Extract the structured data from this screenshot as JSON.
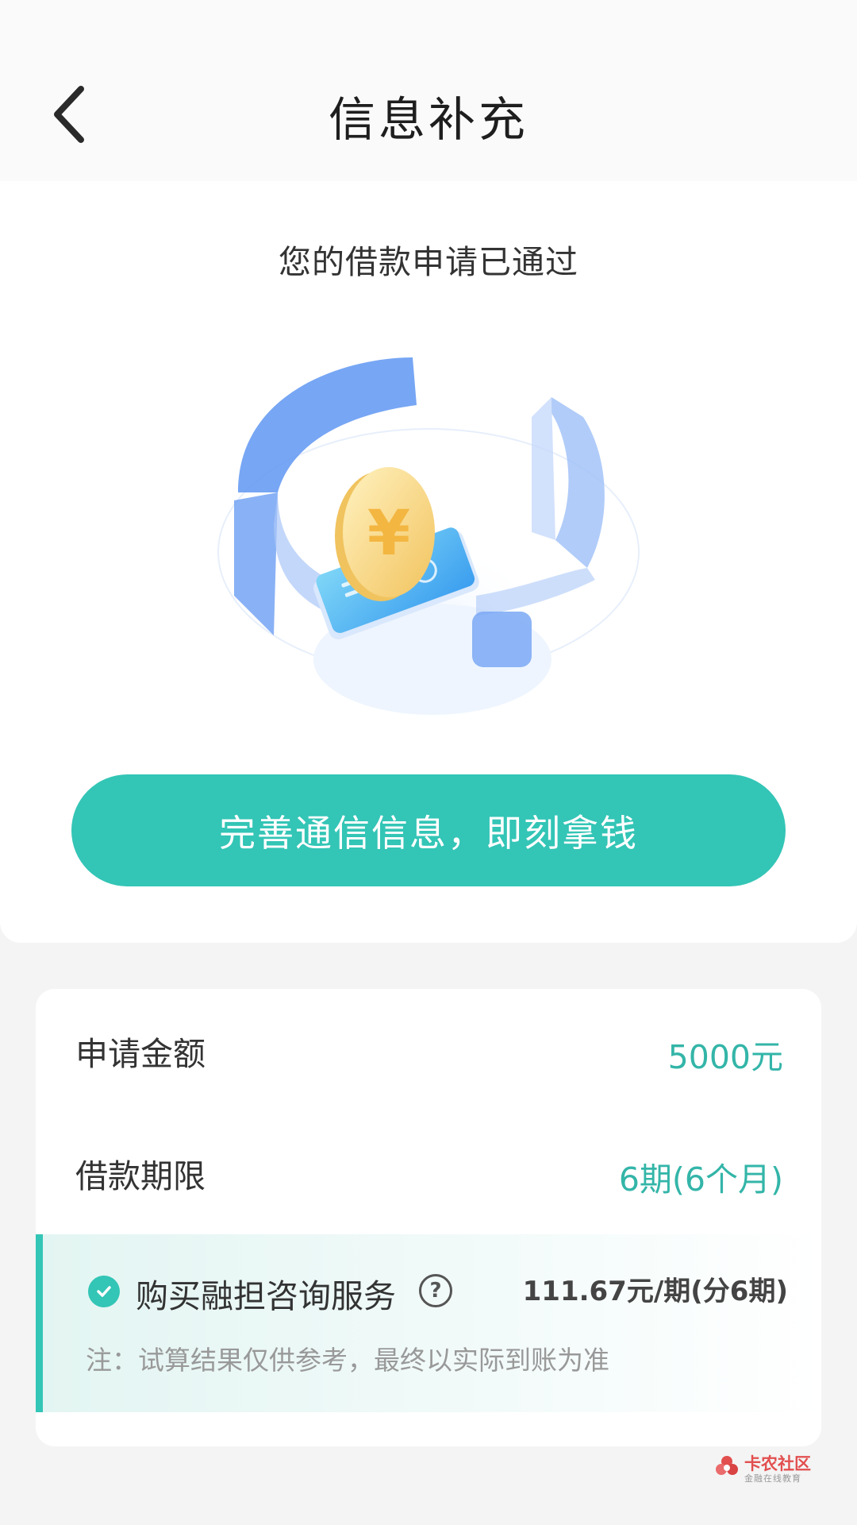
{
  "header": {
    "title": "信息补充",
    "back_icon": "chevron-left-icon"
  },
  "main": {
    "approved_text": "您的借款申请已通过",
    "illustration_icon": "yuan-coin-phone-illustration",
    "cta_label": "完善通信信息，即刻拿钱"
  },
  "details": {
    "amount_label": "申请金额",
    "amount_value": "5000元",
    "term_label": "借款期限",
    "term_value": "6期(6个月)",
    "service": {
      "checked": true,
      "label": "购买融担咨询服务",
      "help_icon_text": "?",
      "price": "111.67元/期(分6期)",
      "note": "注：试算结果仅供参考，最终以实际到账为准"
    }
  },
  "watermark": {
    "title": "卡农社区",
    "subtitle": "金融在线教育"
  },
  "colors": {
    "accent": "#33c5b6",
    "value_text": "#33b5a8",
    "background": "#f4f4f4"
  }
}
